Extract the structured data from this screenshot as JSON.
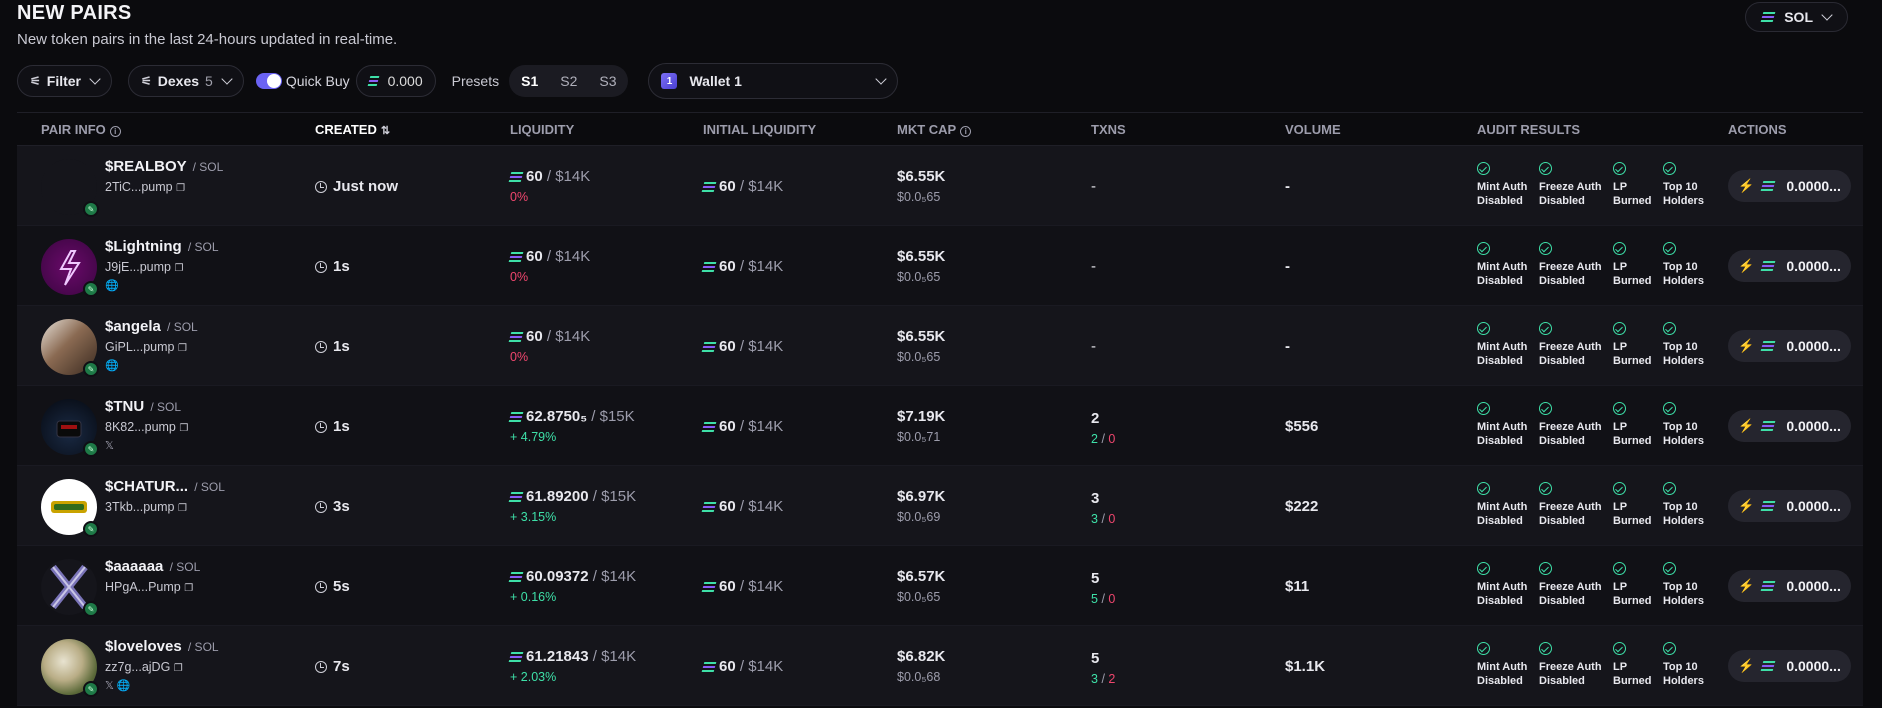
{
  "header": {
    "title": "NEW PAIRS",
    "subtitle": "New token pairs in the last 24-hours updated in real-time.",
    "chain_select": "SOL"
  },
  "toolbar": {
    "filter_label": "Filter",
    "dexes_label": "Dexes",
    "dexes_count": "5",
    "quick_buy_label": "Quick Buy",
    "quick_buy_enabled": true,
    "amount_value": "0.000",
    "presets_label": "Presets",
    "presets": [
      "S1",
      "S2",
      "S3"
    ],
    "active_preset": "S1",
    "wallet_label": "Wallet 1",
    "wallet_icon_text": "1"
  },
  "columns": {
    "pair_info": "PAIR INFO",
    "created": "CREATED",
    "liquidity": "LIQUIDITY",
    "initial_liquidity": "INITIAL LIQUIDITY",
    "mkt_cap": "MKT CAP",
    "txns": "TXNS",
    "volume": "VOLUME",
    "audit_results": "AUDIT RESULTS",
    "actions": "ACTIONS"
  },
  "audit_labels": {
    "mint": [
      "Mint Auth",
      "Disabled"
    ],
    "freeze": [
      "Freeze Auth",
      "Disabled"
    ],
    "lp": [
      "LP",
      "Burned"
    ],
    "top10": [
      "Top 10",
      "Holders"
    ]
  },
  "buy_amount": "0.0000...",
  "rows": [
    {
      "name": "$REALBOY",
      "quote": "/ SOL",
      "addr": "2TiC...pump",
      "socials": "",
      "created": "Just now",
      "liq": "60",
      "liq_usd": "/ $14K",
      "liq_change": "0%",
      "liq_dir": "neg",
      "init_liq": "60",
      "init_liq_usd": "/ $14K",
      "mcap": "$6.55K",
      "price": "$0.0₅65",
      "txns": "-",
      "buys": "",
      "sells": "",
      "volume": "-",
      "avatar": "blank"
    },
    {
      "name": "$Lightning",
      "quote": "/ SOL",
      "addr": "J9jE...pump",
      "socials": "🌐",
      "created": "1s",
      "liq": "60",
      "liq_usd": "/ $14K",
      "liq_change": "0%",
      "liq_dir": "neg",
      "init_liq": "60",
      "init_liq_usd": "/ $14K",
      "mcap": "$6.55K",
      "price": "$0.0₅65",
      "txns": "-",
      "buys": "",
      "sells": "",
      "volume": "-",
      "avatar": "lightning"
    },
    {
      "name": "$angela",
      "quote": "/ SOL",
      "addr": "GiPL...pump",
      "socials": "🌐",
      "created": "1s",
      "liq": "60",
      "liq_usd": "/ $14K",
      "liq_change": "0%",
      "liq_dir": "neg",
      "init_liq": "60",
      "init_liq_usd": "/ $14K",
      "mcap": "$6.55K",
      "price": "$0.0₅65",
      "txns": "-",
      "buys": "",
      "sells": "",
      "volume": "-",
      "avatar": "dog"
    },
    {
      "name": "$TNU",
      "quote": "/ SOL",
      "addr": "8K82...pump",
      "socials": "𝕏",
      "created": "1s",
      "liq": "62.8750₅",
      "liq_usd": "/ $15K",
      "liq_change": "+ 4.79%",
      "liq_dir": "pos",
      "init_liq": "60",
      "init_liq_usd": "/ $14K",
      "mcap": "$7.19K",
      "price": "$0.0₅71",
      "txns": "2",
      "buys": "2",
      "sells": "0",
      "volume": "$556",
      "avatar": "car"
    },
    {
      "name": "$CHATUR...",
      "quote": "/ SOL",
      "addr": "3Tkb...pump",
      "socials": "",
      "created": "3s",
      "liq": "61.89200",
      "liq_usd": "/ $15K",
      "liq_change": "+ 3.15%",
      "liq_dir": "pos",
      "init_liq": "60",
      "init_liq_usd": "/ $14K",
      "mcap": "$6.97K",
      "price": "$0.0₅69",
      "txns": "3",
      "buys": "3",
      "sells": "0",
      "volume": "$222",
      "avatar": "logo"
    },
    {
      "name": "$aaaaaa",
      "quote": "/ SOL",
      "addr": "HPgA...Pump",
      "socials": "",
      "created": "5s",
      "liq": "60.09372",
      "liq_usd": "/ $14K",
      "liq_change": "+ 0.16%",
      "liq_dir": "pos",
      "init_liq": "60",
      "init_liq_usd": "/ $14K",
      "mcap": "$6.57K",
      "price": "$0.0₅65",
      "txns": "5",
      "buys": "5",
      "sells": "0",
      "volume": "$11",
      "avatar": "x"
    },
    {
      "name": "$loveloves",
      "quote": "/ SOL",
      "addr": "zz7g...ajDG",
      "socials": "𝕏 🌐",
      "created": "7s",
      "liq": "61.21843",
      "liq_usd": "/ $14K",
      "liq_change": "+ 2.03%",
      "liq_dir": "pos",
      "init_liq": "60",
      "init_liq_usd": "/ $14K",
      "mcap": "$6.82K",
      "price": "$0.0₅68",
      "txns": "5",
      "buys": "3",
      "sells": "2",
      "volume": "$1.1K",
      "avatar": "camo"
    }
  ]
}
